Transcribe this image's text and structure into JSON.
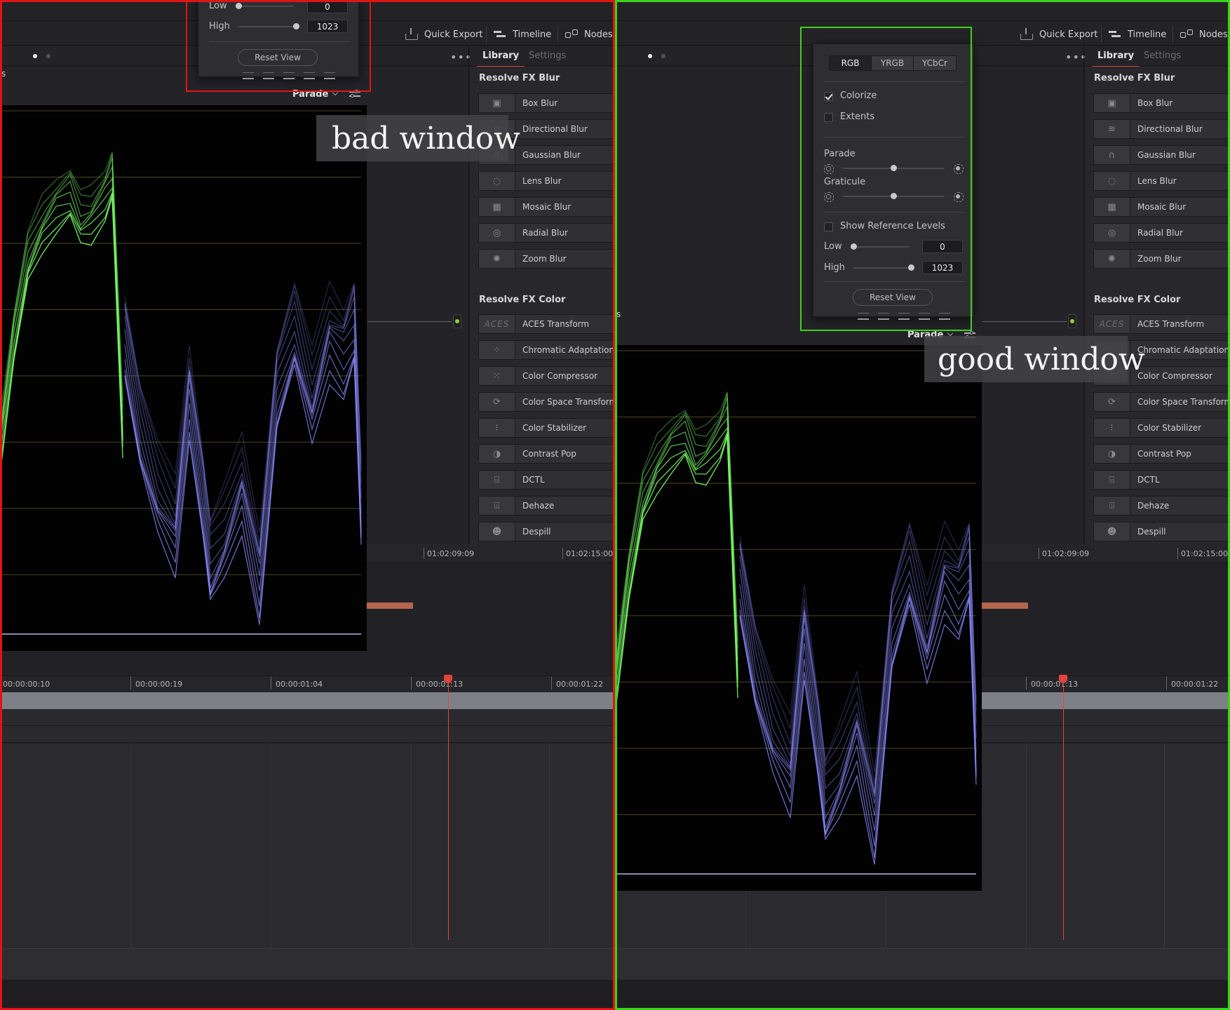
{
  "header": {
    "quick_export": "Quick Export",
    "timeline": "Timeline",
    "nodes": "Nodes"
  },
  "library": {
    "tab_library": "Library",
    "tab_settings": "Settings",
    "section_blur": "Resolve FX Blur",
    "blur_items": [
      "Box Blur",
      "Directional Blur",
      "Gaussian Blur",
      "Lens Blur",
      "Mosaic Blur",
      "Radial Blur",
      "Zoom Blur"
    ],
    "section_color": "Resolve FX Color",
    "color_items": [
      "ACES Transform",
      "Chromatic Adaptation",
      "Color Compressor",
      "Color Space Transform",
      "Color Stabilizer",
      "Contrast Pop",
      "DCTL",
      "Dehaze",
      "Despill"
    ],
    "aces_thumb": "ACES"
  },
  "timeline": {
    "ruler_top": [
      "01:02:09:09",
      "01:02:15:00"
    ],
    "ruler_bottom": [
      "00:00:00:10",
      "00:00:00:19",
      "00:00:01:04",
      "00:00:01:13",
      "00:00:01:22"
    ]
  },
  "scope": {
    "mode": "Parade",
    "side_letter": "s"
  },
  "popup": {
    "color_modes": [
      "RGB",
      "YRGB",
      "YCbCr"
    ],
    "selected_mode": "RGB",
    "colorize_label": "Colorize",
    "colorize_checked": true,
    "extents_label": "Extents",
    "extents_checked": false,
    "parade_label": "Parade",
    "parade_level": 0.5,
    "graticule_label": "Graticule",
    "graticule_level": 0.5,
    "show_ref_label": "Show Reference Levels",
    "show_ref_checked": false,
    "low_label": "Low",
    "low_value": "0",
    "high_label": "High",
    "high_value": "1023",
    "reset_label": "Reset View"
  },
  "annotations": {
    "bad": "bad window",
    "good": "good window"
  },
  "colors": {
    "bad_frame": "#e01414",
    "good_frame": "#3cd21e",
    "accent": "#e0443a",
    "green_trace": "#7dff6a",
    "blue_trace": "#8c8cff"
  }
}
